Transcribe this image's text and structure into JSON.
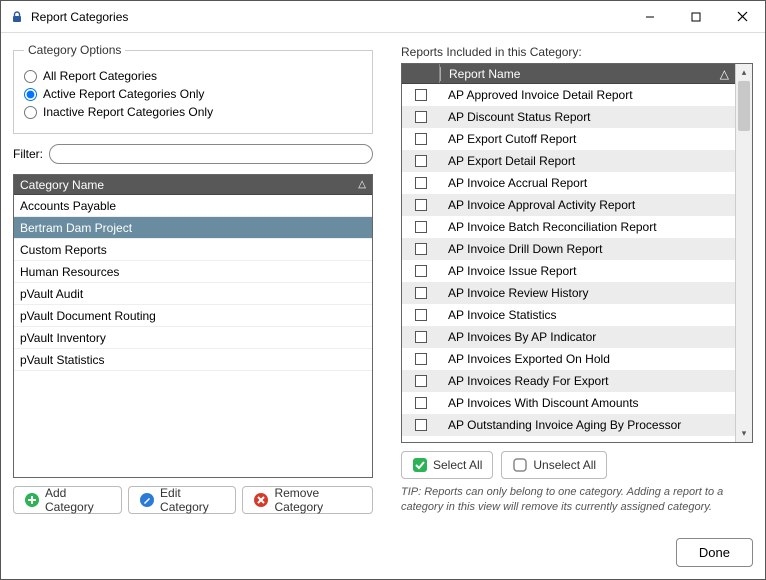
{
  "window": {
    "title": "Report Categories"
  },
  "options": {
    "legend": "Category Options",
    "radio_all": "All Report Categories",
    "radio_active": "Active Report Categories Only",
    "radio_inactive": "Inactive Report Categories Only",
    "selected": "active"
  },
  "filter": {
    "label": "Filter:",
    "value": ""
  },
  "categories": {
    "header": "Category Name",
    "items": [
      "Accounts Payable",
      "Bertram Dam Project",
      "Custom Reports",
      "Human Resources",
      "pVault Audit",
      "pVault Document Routing",
      "pVault Inventory",
      "pVault Statistics"
    ],
    "selected_index": 1
  },
  "category_buttons": {
    "add": "Add Category",
    "edit": "Edit Category",
    "remove": "Remove Category"
  },
  "reports": {
    "label": "Reports Included in this Category:",
    "header": "Report Name",
    "items": [
      "AP Approved Invoice Detail Report",
      "AP Discount Status Report",
      "AP Export Cutoff Report",
      "AP Export Detail Report",
      "AP Invoice Accrual Report",
      "AP Invoice Approval Activity Report",
      "AP Invoice Batch Reconciliation Report",
      "AP Invoice Drill Down Report",
      "AP Invoice Issue Report",
      "AP Invoice Review History",
      "AP Invoice Statistics",
      "AP Invoices By AP Indicator",
      "AP Invoices Exported On Hold",
      "AP Invoices Ready For Export",
      "AP Invoices With Discount Amounts",
      "AP Outstanding Invoice Aging By Processor"
    ]
  },
  "select_buttons": {
    "select_all": "Select All",
    "unselect_all": "Unselect All"
  },
  "tip": "TIP:  Reports can only belong to one category.  Adding a report to a category in this view will remove its currently assigned category.",
  "footer": {
    "done": "Done"
  }
}
